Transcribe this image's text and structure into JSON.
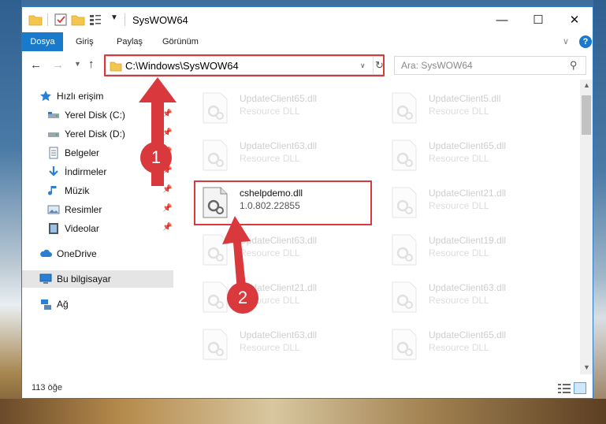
{
  "window": {
    "title": "SysWOW64",
    "min_glyph": "—",
    "max_glyph": "☐",
    "close_glyph": "✕"
  },
  "ribbon": {
    "tabs": [
      "Dosya",
      "Giriş",
      "Paylaş",
      "Görünüm"
    ],
    "help_label": "?"
  },
  "address": {
    "path": "C:\\Windows\\SysWOW64",
    "refresh_glyph": "↻"
  },
  "search": {
    "placeholder": "Ara: SysWOW64"
  },
  "nav_pane": {
    "items": [
      {
        "label": "Hızlı erişim",
        "icon": "star-icon"
      },
      {
        "label": "Yerel Disk (C:)",
        "icon": "drive-icon"
      },
      {
        "label": "Yerel Disk (D:)",
        "icon": "drive-icon"
      },
      {
        "label": "Belgeler",
        "icon": "documents-icon"
      },
      {
        "label": "İndirmeler",
        "icon": "download-icon"
      },
      {
        "label": "Müzik",
        "icon": "music-icon"
      },
      {
        "label": "Resimler",
        "icon": "pictures-icon"
      },
      {
        "label": "Videolar",
        "icon": "videos-icon"
      },
      {
        "label": "OneDrive",
        "icon": "cloud-icon"
      },
      {
        "label": "Bu bilgisayar",
        "icon": "computer-icon"
      },
      {
        "label": "Ağ",
        "icon": "network-icon"
      }
    ]
  },
  "files": [
    {
      "name": "UpdateClient65.dll",
      "desc": "Resource DLL"
    },
    {
      "name": "UpdateClient5.dll",
      "desc": "Resource DLL"
    },
    {
      "name": "UpdateClient63.dll",
      "desc": "Resource DLL"
    },
    {
      "name": "UpdateClient65.dll",
      "desc": "Resource DLL"
    },
    {
      "name": "cshelpdemo.dll",
      "desc": "1.0.802.22855"
    },
    {
      "name": "UpdateClient21.dll",
      "desc": "Resource DLL"
    },
    {
      "name": "UpdateClient63.dll",
      "desc": "Resource DLL"
    },
    {
      "name": "UpdateClient19.dll",
      "desc": "Resource DLL"
    },
    {
      "name": "UpdateClient21.dll",
      "desc": "Resource DLL"
    },
    {
      "name": "UpdateClient63.dll",
      "desc": "Resource DLL"
    },
    {
      "name": "UpdateClient63.dll",
      "desc": "Resource DLL"
    },
    {
      "name": "UpdateClient65.dll",
      "desc": "Resource DLL"
    }
  ],
  "status": {
    "count": "113 öğe"
  },
  "annotations": {
    "badge_1": "1",
    "badge_2": "2",
    "color": "#d9393d"
  },
  "colors": {
    "accent": "#1979ca",
    "highlight": "#d9393d",
    "selected_nav": "#e5e5e5"
  }
}
